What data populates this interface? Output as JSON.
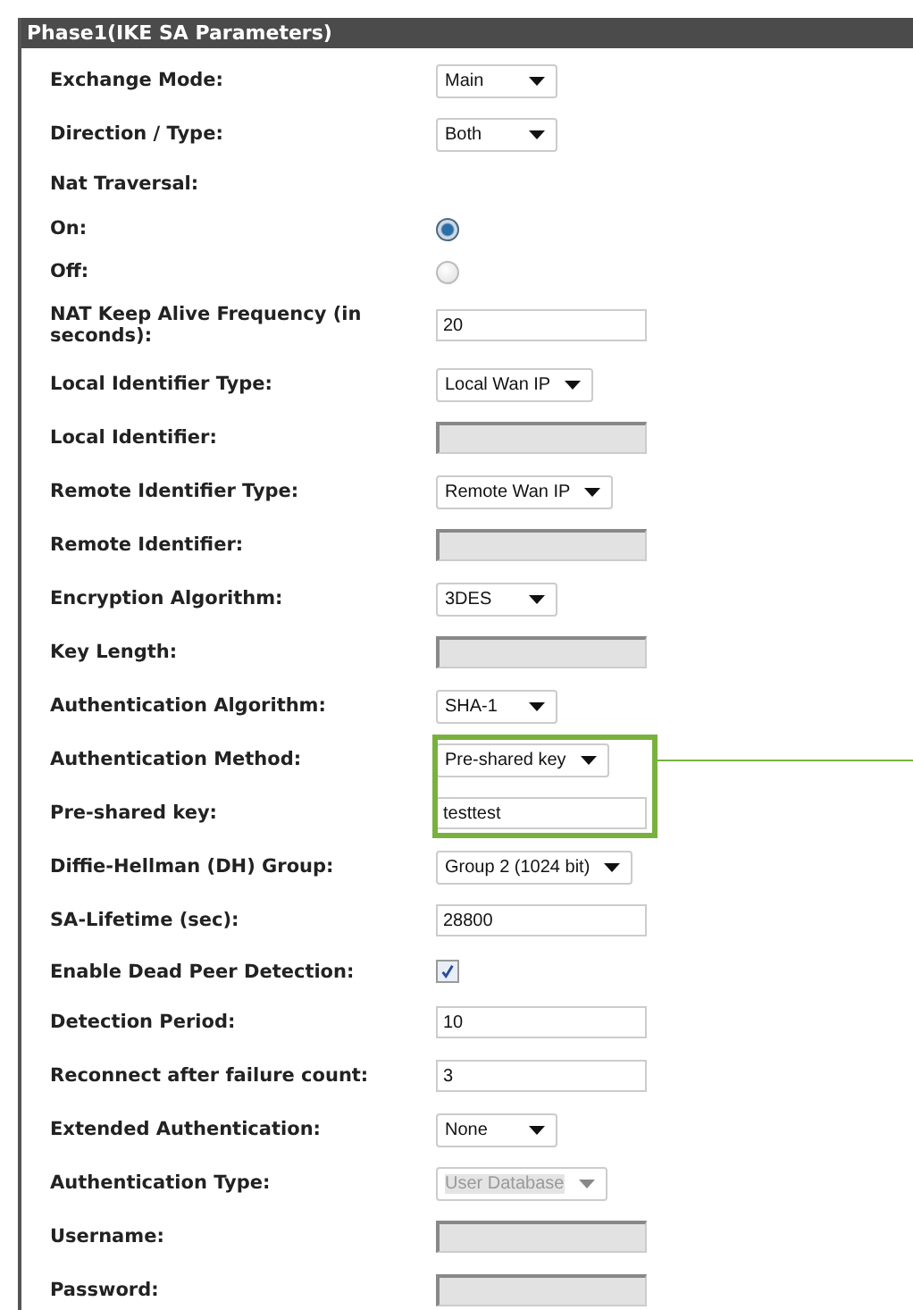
{
  "section": {
    "title": "Phase1(IKE SA Parameters)"
  },
  "rows": [
    {
      "kind": "select",
      "label": "Exchange Mode:",
      "value": "Main",
      "disabled": false,
      "highlighted": false
    },
    {
      "kind": "select",
      "label": "Direction / Type:",
      "value": "Both",
      "disabled": false,
      "highlighted": false
    },
    {
      "kind": "heading",
      "label": "Nat Traversal:",
      "highlighted": false
    },
    {
      "kind": "radio",
      "label": "On:",
      "selected": true,
      "highlighted": false
    },
    {
      "kind": "radio",
      "label": "Off:",
      "selected": false,
      "highlighted": false
    },
    {
      "kind": "text",
      "label": "NAT Keep Alive Frequency (in seconds):",
      "value": "20",
      "disabled": false,
      "highlighted": false
    },
    {
      "kind": "select",
      "label": "Local Identifier Type:",
      "value": "Local Wan IP",
      "disabled": false,
      "highlighted": false
    },
    {
      "kind": "text",
      "label": "Local Identifier:",
      "disabled": true,
      "highlighted": false
    },
    {
      "kind": "select",
      "label": "Remote Identifier Type:",
      "value": "Remote Wan IP",
      "disabled": false,
      "highlighted": false
    },
    {
      "kind": "text",
      "label": "Remote Identifier:",
      "disabled": true,
      "highlighted": false
    },
    {
      "kind": "select",
      "label": "Encryption Algorithm:",
      "value": "3DES",
      "disabled": false,
      "highlighted": false
    },
    {
      "kind": "text",
      "label": "Key Length:",
      "disabled": true,
      "highlighted": false
    },
    {
      "kind": "select",
      "label": "Authentication Algorithm:",
      "value": "SHA-1",
      "disabled": false,
      "highlighted": false
    },
    {
      "kind": "select",
      "label": "Authentication Method:",
      "value": "Pre-shared key",
      "disabled": false,
      "highlighted": true
    },
    {
      "kind": "text",
      "label": "Pre-shared key:",
      "value": "testtest",
      "disabled": false,
      "highlighted": true
    },
    {
      "kind": "select",
      "label": "Diffie-Hellman (DH) Group:",
      "value": "Group 2 (1024 bit)",
      "disabled": false,
      "highlighted": false
    },
    {
      "kind": "text",
      "label": "SA-Lifetime (sec):",
      "value": "28800",
      "disabled": false,
      "highlighted": false
    },
    {
      "kind": "checkbox",
      "label": "Enable Dead Peer Detection:",
      "checked": true,
      "highlighted": false
    },
    {
      "kind": "text",
      "label": "Detection Period:",
      "value": "10",
      "disabled": false,
      "highlighted": false
    },
    {
      "kind": "text",
      "label": "Reconnect after failure count:",
      "value": "3",
      "disabled": false,
      "highlighted": false
    },
    {
      "kind": "select",
      "label": "Extended Authentication:",
      "value": "None",
      "disabled": false,
      "highlighted": false
    },
    {
      "kind": "select",
      "label": "Authentication Type:",
      "value": "User Database",
      "disabled": true,
      "highlighted": false
    },
    {
      "kind": "text",
      "label": "Username:",
      "disabled": true,
      "highlighted": false
    },
    {
      "kind": "text",
      "label": "Password:",
      "disabled": true,
      "highlighted": false
    }
  ]
}
